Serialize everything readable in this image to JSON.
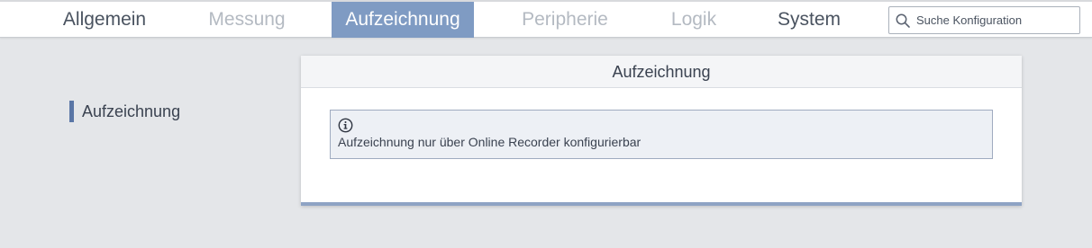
{
  "nav": {
    "tabs": [
      {
        "label": "Allgemein",
        "state": "enabled"
      },
      {
        "label": "Messung",
        "state": "disabled"
      },
      {
        "label": "Aufzeichnung",
        "state": "active"
      },
      {
        "label": "Peripherie",
        "state": "disabled"
      },
      {
        "label": "Logik",
        "state": "disabled"
      },
      {
        "label": "System",
        "state": "enabled"
      }
    ],
    "search": {
      "placeholder": "Suche Konfiguration",
      "value": "",
      "icon": "search-icon"
    }
  },
  "sidebar": {
    "items": [
      {
        "label": "Aufzeichnung",
        "selected": true
      }
    ]
  },
  "panel": {
    "title": "Aufzeichnung",
    "info": {
      "icon": "info-icon",
      "text": "Aufzeichnung nur über Online Recorder konfigurierbar"
    }
  },
  "colors": {
    "accent": "#7f9bc3",
    "marker": "#5a76a6",
    "panel_bottom_border": "#8ea3c4",
    "background": "#e4e6e9"
  }
}
